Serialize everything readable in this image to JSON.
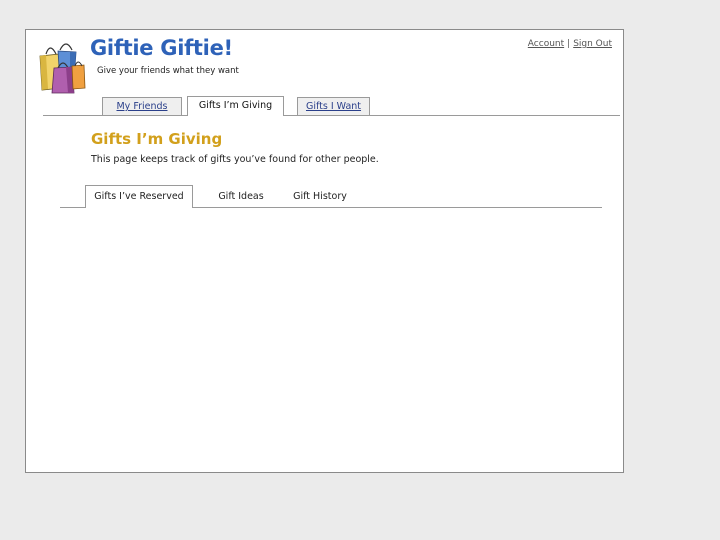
{
  "header": {
    "title": "Giftie Giftie!",
    "tagline": "Give your friends what they want",
    "logo_icon": "shopping-bags-icon"
  },
  "account": {
    "account_label": "Account",
    "separator": "|",
    "signout_label": "Sign Out"
  },
  "main_tabs": [
    {
      "label": "My Friends",
      "active": false
    },
    {
      "label": "Gifts I’m Giving",
      "active": true
    },
    {
      "label": "Gifts I Want",
      "active": false
    }
  ],
  "section": {
    "title": "Gifts I’m Giving",
    "description": "This page keeps track of gifts you’ve found for other people."
  },
  "sub_tabs": [
    {
      "label": "Gifts I’ve Reserved",
      "active": true
    },
    {
      "label": "Gift Ideas",
      "active": false
    },
    {
      "label": "Gift History",
      "active": false
    }
  ],
  "colors": {
    "title_blue": "#2e62b8",
    "section_gold": "#d2a01c",
    "link_blue": "#2a3f8a",
    "background": "#ebebeb"
  }
}
